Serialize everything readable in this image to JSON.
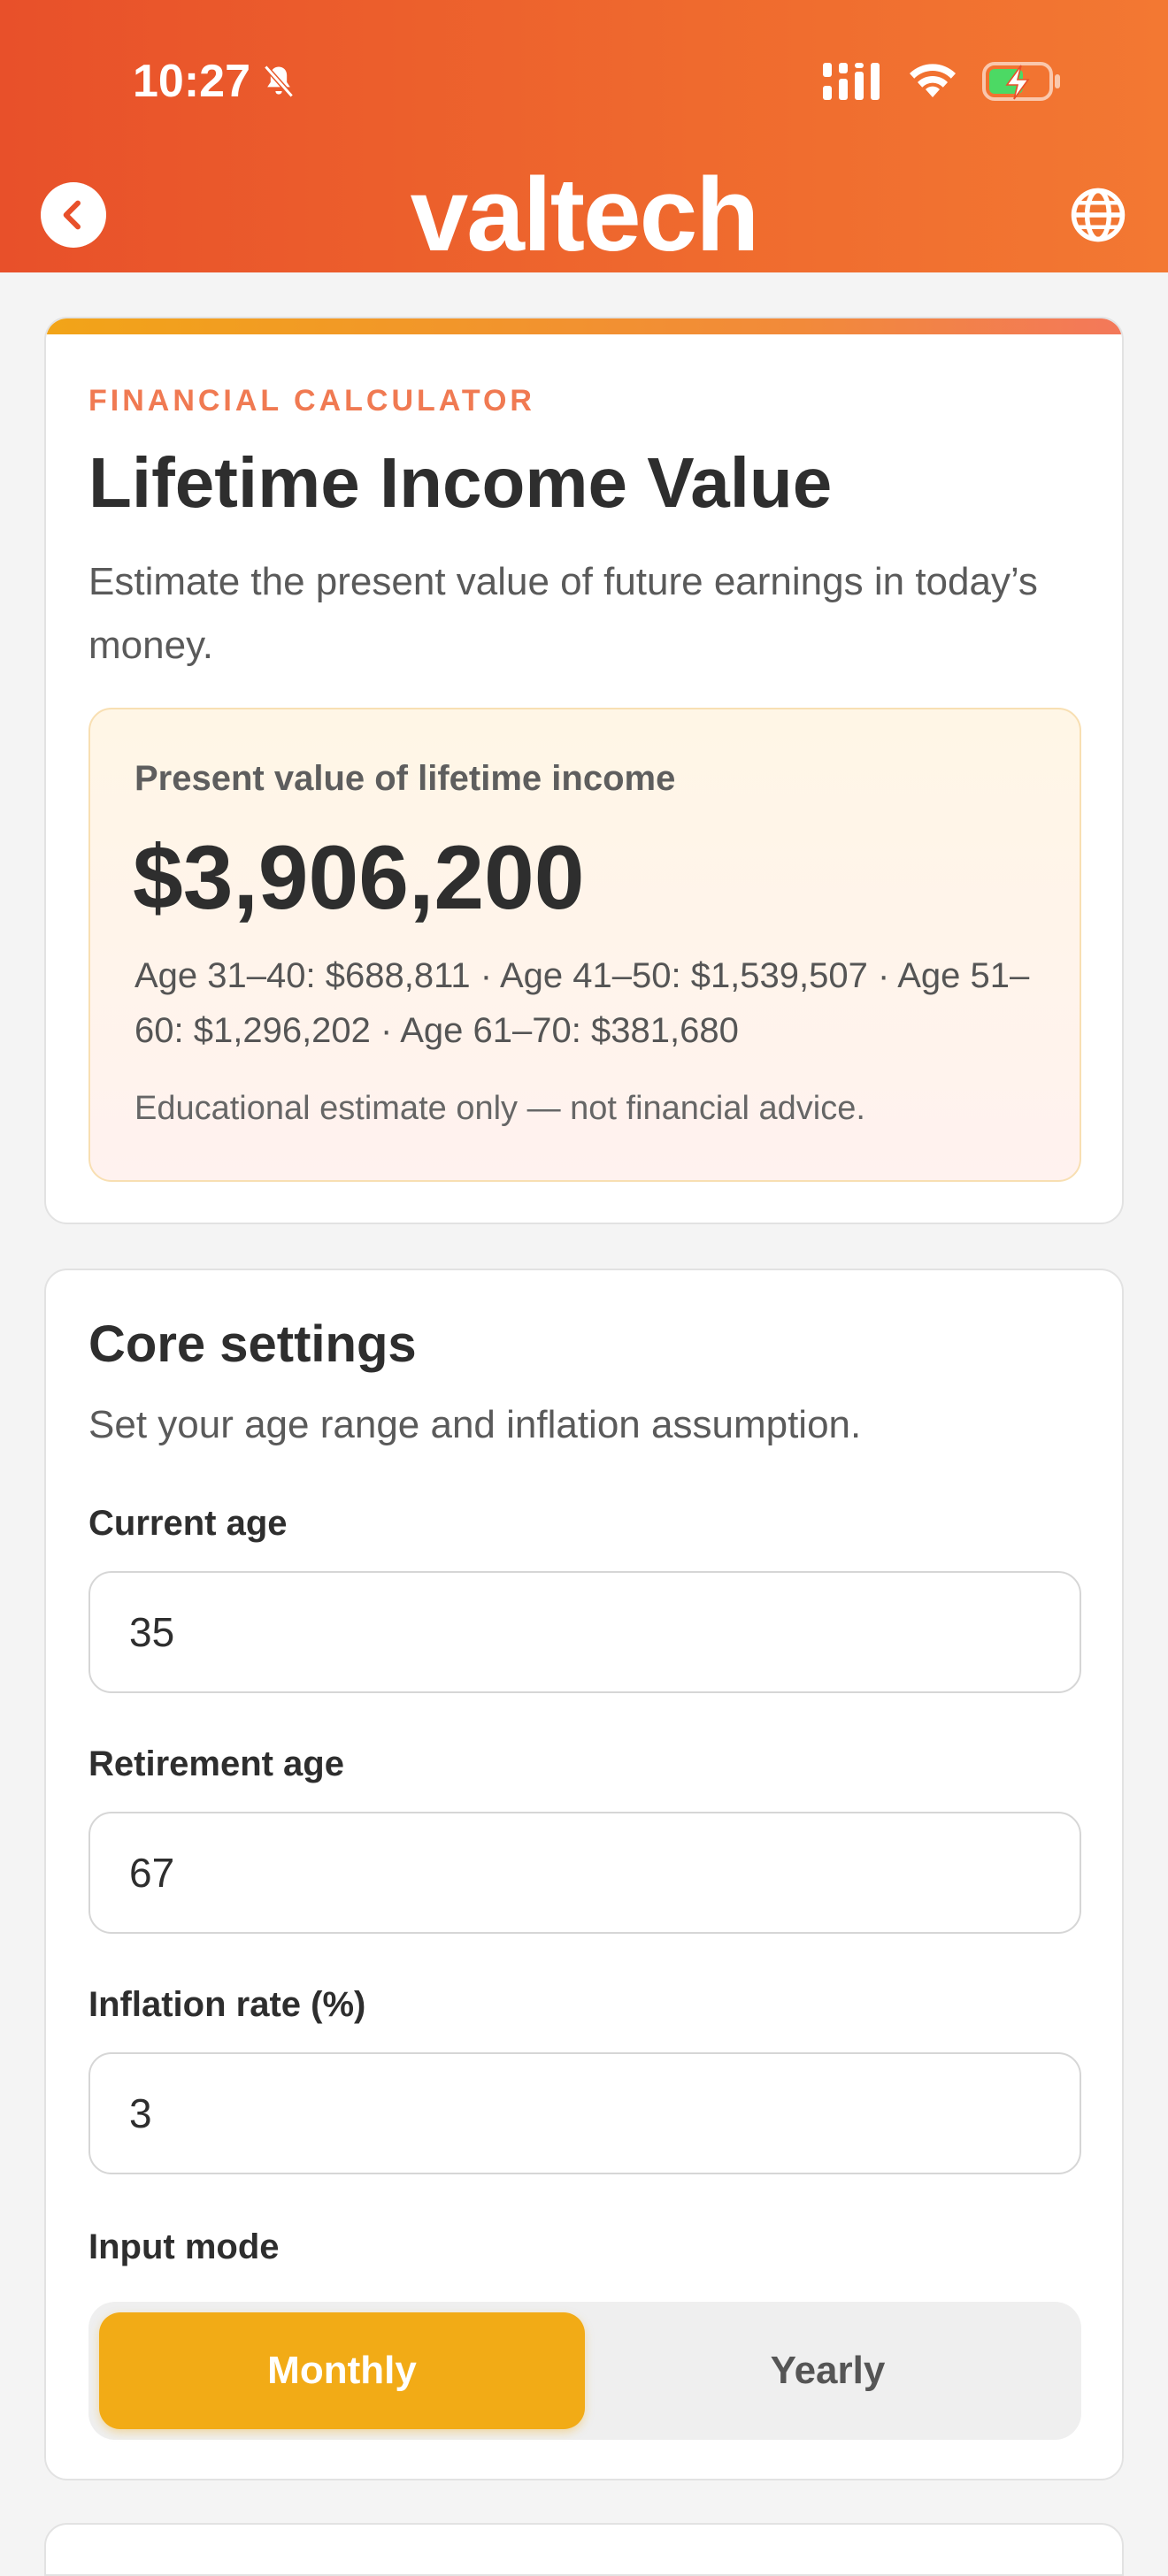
{
  "status_bar": {
    "time": "10:27"
  },
  "header": {
    "brand": "valtech"
  },
  "summary_card": {
    "eyebrow": "FINANCIAL CALCULATOR",
    "title": "Lifetime Income Value",
    "subtitle": "Estimate the present value of future earnings in today’s money.",
    "result": {
      "label": "Present value of lifetime income",
      "value": "$3,906,200",
      "breakdown": "Age 31–40: $688,811 · Age 41–50: $1,539,507 · Age 51–60: $1,296,202 · Age 61–70: $381,680",
      "note": "Educational estimate only — not financial advice."
    }
  },
  "core_settings": {
    "heading": "Core settings",
    "description": "Set your age range and inflation assumption.",
    "current_age": {
      "label": "Current age",
      "value": "35"
    },
    "retirement_age": {
      "label": "Retirement age",
      "value": "67"
    },
    "inflation_rate": {
      "label": "Inflation rate (%)",
      "value": "3"
    },
    "input_mode": {
      "label": "Input mode",
      "options": [
        "Monthly",
        "Yearly"
      ],
      "selected": "Monthly"
    }
  },
  "colors": {
    "header_start": "#e8502a",
    "header_end": "#f37832",
    "accent": "#f2ab16",
    "eyebrow": "#f07a52"
  }
}
